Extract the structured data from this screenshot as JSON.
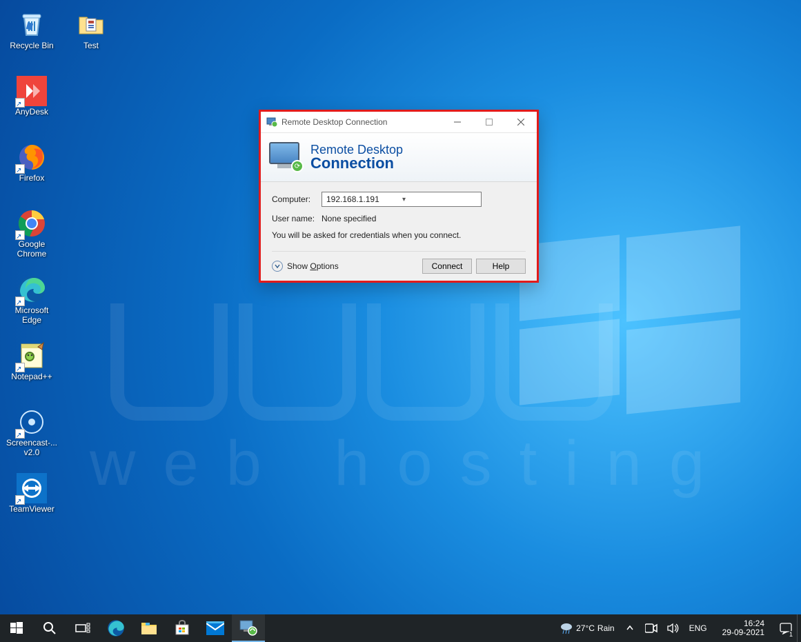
{
  "desktop_icons": {
    "recycle_bin": "Recycle Bin",
    "test": "Test",
    "anydesk": "AnyDesk",
    "firefox": "Firefox",
    "chrome": "Google Chrome",
    "edge": "Microsoft Edge",
    "npp": "Notepad++",
    "screencast": "Screencast-... v2.0",
    "teamviewer": "TeamViewer"
  },
  "watermark": "web hosting",
  "rdc": {
    "title": "Remote Desktop Connection",
    "heading_line1": "Remote Desktop",
    "heading_line2": "Connection",
    "computer_label": "Computer:",
    "computer_value": "192.168.1.191",
    "username_label": "User name:",
    "username_value": "None specified",
    "hint": "You will be asked for credentials when you connect.",
    "show_options": "Show Options",
    "connect": "Connect",
    "help": "Help"
  },
  "taskbar": {
    "weather_temp": "27°C",
    "weather_desc": "Rain",
    "lang": "ENG",
    "time": "16:24",
    "date": "29-09-2021",
    "notif_count": "1"
  }
}
